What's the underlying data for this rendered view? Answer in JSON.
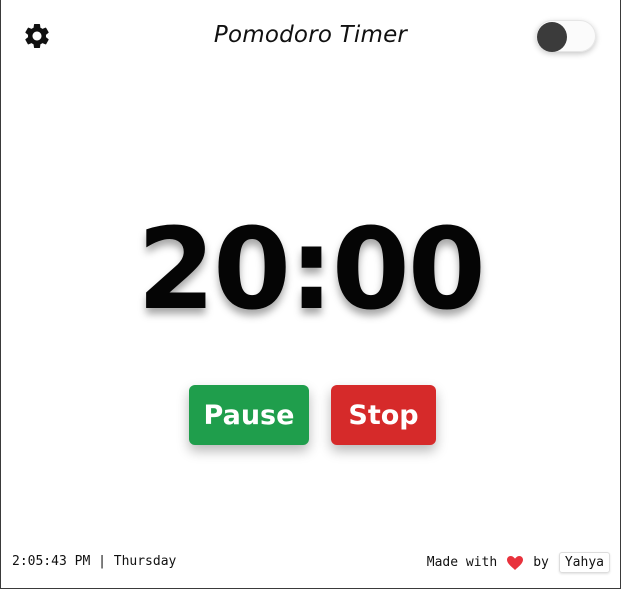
{
  "header": {
    "title": "Pomodoro Timer",
    "settings_icon": "gear-icon",
    "theme_toggle": {
      "state": "off"
    }
  },
  "timer": {
    "display": "20:00"
  },
  "controls": {
    "pause_label": "Pause",
    "stop_label": "Stop",
    "pause_color": "#1f9e4c",
    "stop_color": "#d62a2a"
  },
  "footer": {
    "clock": "2:05:43 PM | Thursday",
    "made_with": "Made with",
    "heart_icon": "heart-icon",
    "heart_color": "#e8323c",
    "by": "by",
    "author": "Yahya"
  }
}
